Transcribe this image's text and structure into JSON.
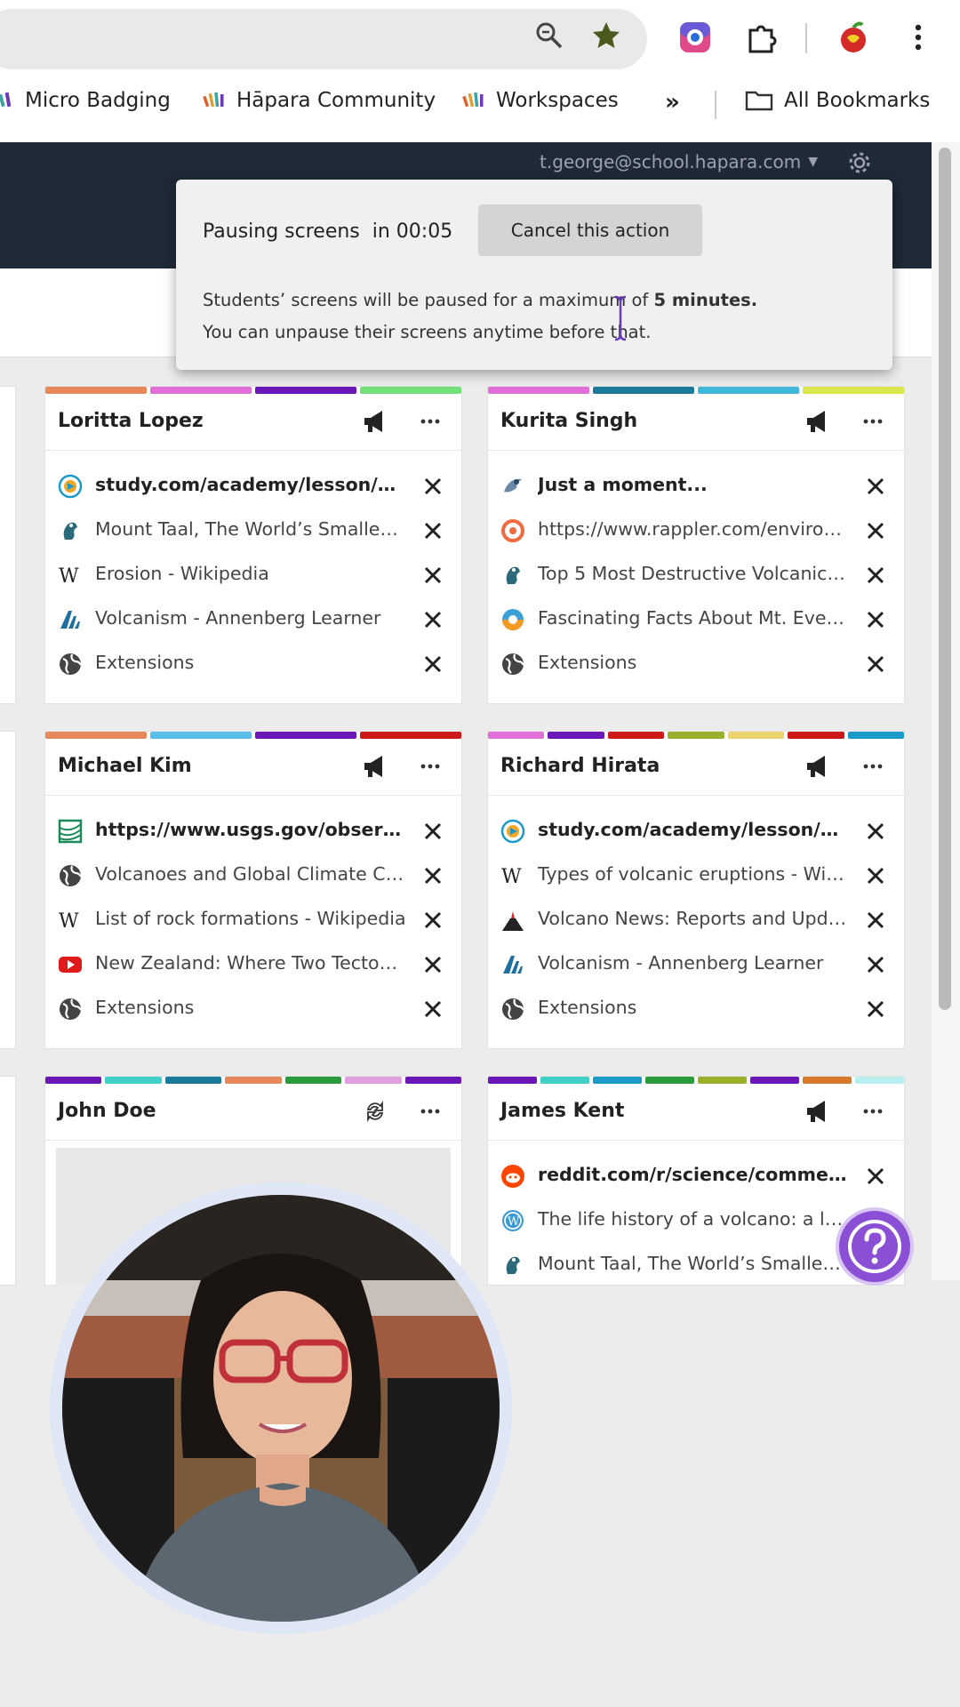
{
  "browser": {
    "bookmarks": [
      "Micro Badging",
      "Hāpara Community",
      "Workspaces"
    ],
    "more_label": "»",
    "all_bookmarks": "All Bookmarks"
  },
  "header": {
    "user_email": "t.george@school.hapara.com"
  },
  "toast": {
    "countdown_label": "Pausing screens  in 00:05",
    "cancel_label": "Cancel this action",
    "msg_line1_prefix": "Students’ screens will be paused for a maximum of ",
    "msg_line1_bold": "5 minutes.",
    "msg_line2": "You can unpause their screens anytime before that."
  },
  "cards": [
    {
      "name": "Loritta Lopez",
      "stripe": [
        "#e8885a",
        "#e070d8",
        "#6b17b8",
        "#74e07a"
      ],
      "tabs": [
        {
          "icon": "study-icon",
          "title": "study.com/academy/lesson/w...",
          "active": true
        },
        {
          "icon": "site-icon",
          "title": "Mount Taal, The World’s Smallest...",
          "active": false
        },
        {
          "icon": "wikipedia-icon",
          "title": "Erosion - Wikipedia",
          "active": false
        },
        {
          "icon": "annenberg-icon",
          "title": "Volcanism - Annenberg Learner",
          "active": false
        },
        {
          "icon": "globe-icon",
          "title": "Extensions",
          "active": false
        }
      ]
    },
    {
      "name": "Kurita Singh",
      "stripe": [
        "#e070d8",
        "#1b7a99",
        "#40b6d8",
        "#d8e84a"
      ],
      "tabs": [
        {
          "icon": "loading-icon",
          "title": "Just a moment...",
          "active": true
        },
        {
          "icon": "rappler-icon",
          "title": "https://www.rappler.com/environ...",
          "active": false
        },
        {
          "icon": "site-icon",
          "title": "Top 5 Most Destructive Volcanic ...",
          "active": false
        },
        {
          "icon": "sunrise-icon",
          "title": "Fascinating Facts About Mt. Everest",
          "active": false
        },
        {
          "icon": "globe-icon",
          "title": "Extensions",
          "active": false
        }
      ]
    },
    {
      "name": "Michael Kim",
      "stripe": [
        "#e8885a",
        "#58c0e8",
        "#6b17b8",
        "#cc1a1a"
      ],
      "tabs": [
        {
          "icon": "usgs-icon",
          "title": "https://www.usgs.gov/observa...",
          "active": true
        },
        {
          "icon": "globe-icon",
          "title": "Volcanoes and Global Climate Ch...",
          "active": false
        },
        {
          "icon": "wikipedia-icon",
          "title": "List of rock formations - Wikipedia",
          "active": false
        },
        {
          "icon": "youtube-icon",
          "title": "New Zealand: Where Two Tectoni...",
          "active": false
        },
        {
          "icon": "globe-icon",
          "title": "Extensions",
          "active": false
        }
      ]
    },
    {
      "name": "Richard Hirata",
      "stripe": [
        "#e070d8",
        "#6b17b8",
        "#cc1a1a",
        "#9ab02a",
        "#ecd36a",
        "#cc1a1a",
        "#1b9ac9"
      ],
      "tabs": [
        {
          "icon": "study-icon",
          "title": "study.com/academy/lesson/w...",
          "active": true
        },
        {
          "icon": "wikipedia-icon",
          "title": "Types of volcanic eruptions - Wiki...",
          "active": false
        },
        {
          "icon": "volcano-icon",
          "title": "Volcano News: Reports and Upda...",
          "active": false
        },
        {
          "icon": "annenberg-icon",
          "title": "Volcanism - Annenberg Learner",
          "active": false
        },
        {
          "icon": "globe-icon",
          "title": "Extensions",
          "active": false
        }
      ]
    },
    {
      "name": "John Doe",
      "stripe": [
        "#6b17b8",
        "#40d0c8",
        "#1b7a99",
        "#e8885a",
        "#2a9a3a",
        "#e0a0e0",
        "#6b17b8"
      ],
      "tabs": []
    },
    {
      "name": "James Kent",
      "stripe": [
        "#6b17b8",
        "#40d0c8",
        "#1b9ac9",
        "#2a9a3a",
        "#9ab02a",
        "#6b17b8",
        "#d8792a",
        "#b8f0f0"
      ],
      "tabs": [
        {
          "icon": "reddit-icon",
          "title": "reddit.com/r/science/commen...",
          "active": true
        },
        {
          "icon": "wordpress-icon",
          "title": "The life history of a volcano: a lec...",
          "active": false
        },
        {
          "icon": "site-icon",
          "title": "Mount Taal, The World’s Smallest...",
          "active": false
        }
      ]
    }
  ]
}
